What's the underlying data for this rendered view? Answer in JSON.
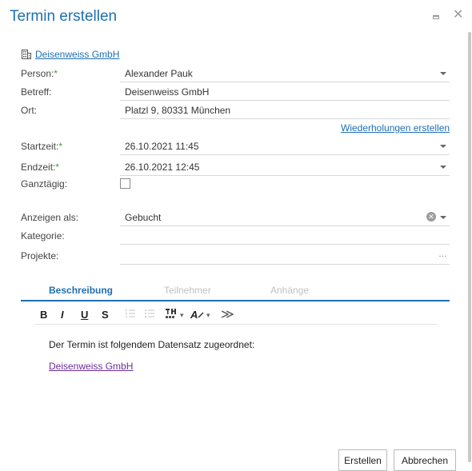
{
  "dialog": {
    "title": "Termin erstellen"
  },
  "company_link": "Deisenweiss GmbH",
  "fields": {
    "person": {
      "label": "Person:",
      "value": "Alexander Pauk"
    },
    "betreff": {
      "label": "Betreff:",
      "value": "Deisenweiss GmbH"
    },
    "ort": {
      "label": "Ort:",
      "value": "Platzl 9, 80331 München"
    },
    "startzeit": {
      "label": "Startzeit:",
      "value": "26.10.2021 11:45"
    },
    "endzeit": {
      "label": "Endzeit:",
      "value": "26.10.2021 12:45"
    },
    "ganztaegig": {
      "label": "Ganztägig:",
      "checked": false
    },
    "anzeigen_als": {
      "label": "Anzeigen als:",
      "value": "Gebucht"
    },
    "kategorie": {
      "label": "Kategorie:",
      "value": ""
    },
    "projekte": {
      "label": "Projekte:",
      "value": ""
    }
  },
  "required_marker": "*",
  "repeat_link": "Wiederholungen erstellen",
  "tabs": [
    {
      "label": "Beschreibung",
      "active": true
    },
    {
      "label": "Teilnehmer",
      "active": false
    },
    {
      "label": "Anhänge",
      "active": false
    }
  ],
  "toolbar": {
    "bold": "B",
    "italic": "I",
    "underline": "U",
    "strike": "S",
    "font_color": "A"
  },
  "editor": {
    "text": "Der Termin ist folgendem Datensatz zugeordnet:",
    "link": "Deisenweiss GmbH"
  },
  "buttons": {
    "create": "Erstellen",
    "cancel": "Abbrechen"
  },
  "colors": {
    "accent": "#1f6fb2",
    "required": "#3aa040",
    "visited_link": "#6b2d9b"
  }
}
